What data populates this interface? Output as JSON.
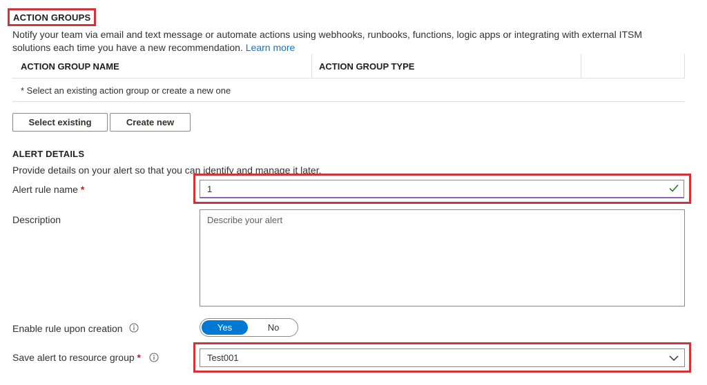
{
  "action_groups": {
    "title": "ACTION GROUPS",
    "description_line1": "Notify your team via email and text message or automate actions using webhooks, runbooks, functions, logic apps or integrating with external ITSM",
    "description_line2": "solutions each time you have a new recommendation.",
    "learn_more": "Learn more",
    "columns": [
      "ACTION GROUP NAME",
      "ACTION GROUP TYPE"
    ],
    "empty_message": "* Select an existing action group or create a new one",
    "select_existing_label": "Select existing",
    "create_new_label": "Create new"
  },
  "alert_details": {
    "title": "ALERT DETAILS",
    "description": "Provide details on your alert so that you can identify and manage it later.",
    "rule_name_label": "Alert rule name",
    "rule_name_value": "1",
    "description_label": "Description",
    "description_placeholder": "Describe your alert",
    "enable_label": "Enable rule upon creation",
    "toggle_yes": "Yes",
    "toggle_no": "No",
    "resource_group_label": "Save alert to resource group",
    "resource_group_value": "Test001",
    "required_mark": "*"
  },
  "colors": {
    "highlight": "#d13438",
    "accent": "#0078d4",
    "valid": "#107c10",
    "required": "#a4262c"
  }
}
